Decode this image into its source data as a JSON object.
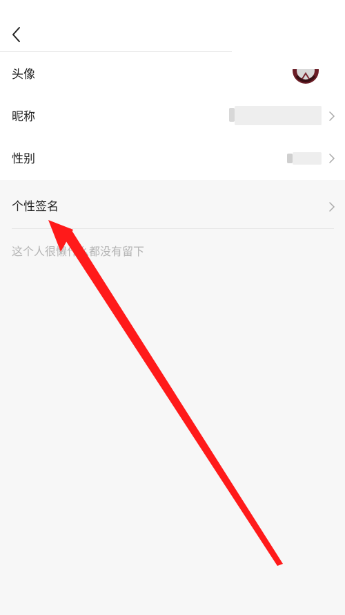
{
  "header": {
    "back_icon": "chevron-left-icon"
  },
  "rows": [
    {
      "label": "头像"
    },
    {
      "label": "昵称"
    },
    {
      "label": "性别"
    },
    {
      "label": "个性签名"
    }
  ],
  "signature": {
    "placeholder": "这个人很懒什么都没有留下"
  },
  "colors": {
    "arrow": "#ff1a1a",
    "background": "#f7f7f7",
    "section": "#ffffff",
    "placeholder": "#b4b4b4"
  }
}
